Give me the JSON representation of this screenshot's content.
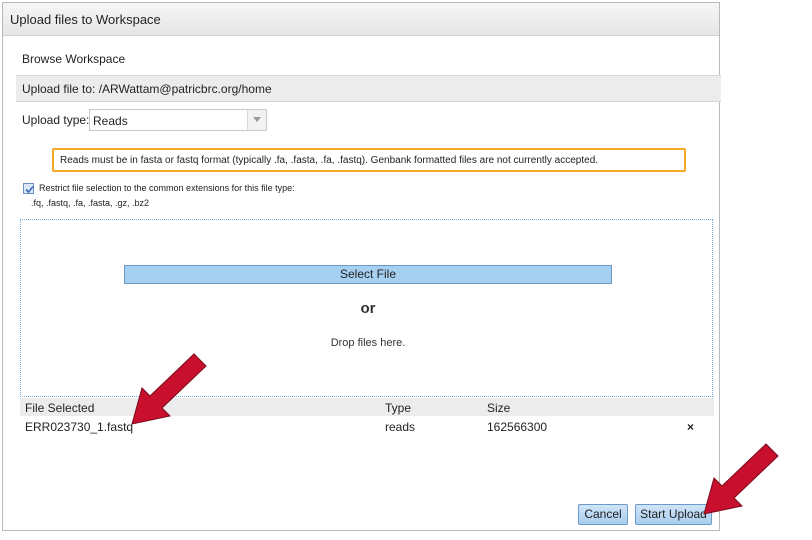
{
  "dialog": {
    "title": "Upload files to Workspace",
    "browse_link": "Browse Workspace",
    "upload_to": "Upload file to: /ARWattam@patricbrc.org/home",
    "upload_type_label": "Upload type:",
    "upload_type_value": "Reads",
    "note": "Reads must be in fasta or fastq format (typically .fa, .fasta, .fa, .fastq). Genbank formatted files are not currently accepted.",
    "restrict_checked": true,
    "restrict_label": "Restrict file selection to the common extensions for this file type:",
    "restrict_extensions": ".fq, .fastq, .fa, .fasta, .gz, .bz2",
    "select_file_label": "Select File",
    "or_label": "or",
    "drop_label": "Drop files here.",
    "table": {
      "headers": [
        "File Selected",
        "Type",
        "Size"
      ],
      "rows": [
        {
          "name": "ERR023730_1.fastq",
          "type": "reads",
          "size": "162566300",
          "delete": "×"
        }
      ]
    },
    "cancel_label": "Cancel",
    "start_label": "Start Upload"
  },
  "colors": {
    "accent_button": "#a9cdee",
    "note_border": "#f5a623",
    "annotation_arrow": "#c8102e"
  },
  "icons": {
    "dropdown": "chevron-down-icon",
    "checkbox": "checkmark-icon",
    "delete": "close-icon",
    "annotation": "red-arrow-icon"
  }
}
